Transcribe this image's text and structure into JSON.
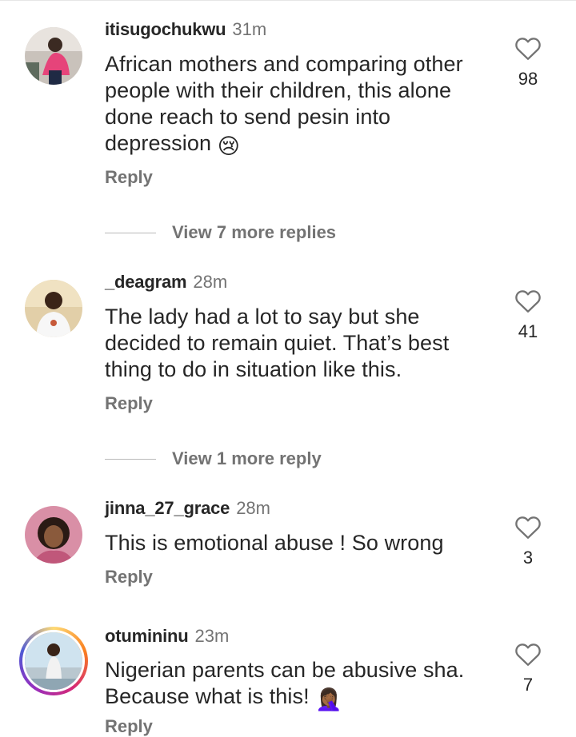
{
  "comments": [
    {
      "username": "itisugochukwu",
      "time": "31m",
      "text": "African mothers and comparing other people with their children, this alone done reach to send pesin into depression",
      "emoji": "😢",
      "reply_label": "Reply",
      "likes": "98",
      "avatar": "user-photo-avatar"
    },
    {
      "username": "_deagram",
      "time": "28m",
      "text": "The lady had a lot to say but she decided to remain quiet. That’s best thing to do in situation like this.",
      "reply_label": "Reply",
      "likes": "41",
      "avatar": "user-photo-avatar"
    },
    {
      "username": "jinna_27_grace",
      "time": "28m",
      "text": "This is emotional abuse ! So wrong",
      "reply_label": "Reply",
      "likes": "3",
      "avatar": "user-photo-avatar"
    },
    {
      "username": "otumininu",
      "time": "23m",
      "text": "Nigerian parents can be abusive sha. Because what is this!",
      "emoji": "🤦🏾‍♀️",
      "reply_label": "Reply",
      "likes": "7",
      "avatar": "story-ring-avatar"
    }
  ],
  "view_more": [
    {
      "label": "View 7 more replies"
    },
    {
      "label": "View 1 more reply"
    }
  ],
  "icons": {
    "like": "heart-outline-icon"
  },
  "colors": {
    "text": "#262626",
    "secondary": "#737373",
    "divider": "#b8b8b8"
  }
}
